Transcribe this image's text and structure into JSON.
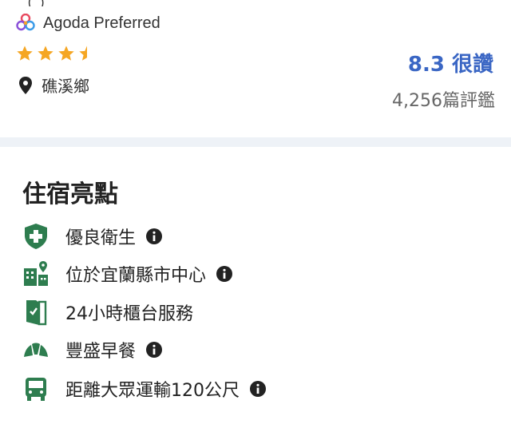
{
  "header": {
    "clipped_text": "（ ）",
    "badge_label": "Agoda Preferred",
    "star_rating": 3.5,
    "location": "礁溪鄉",
    "rating_score": "8.3 很讚",
    "review_count": "4,256篇評鑑"
  },
  "highlights": {
    "title": "住宿亮點",
    "items": [
      {
        "label": "優良衛生",
        "icon": "shield-cross-icon",
        "info": true
      },
      {
        "label": "位於宜蘭縣市中心",
        "icon": "city-center-icon",
        "info": true
      },
      {
        "label": "24小時櫃台服務",
        "icon": "door-check-icon",
        "info": false
      },
      {
        "label": "豐盛早餐",
        "icon": "croissant-icon",
        "info": true
      },
      {
        "label": "距離大眾運輸120公尺",
        "icon": "bus-icon",
        "info": true
      }
    ]
  },
  "colors": {
    "accent_blue": "#3a66c4",
    "icon_green": "#2e7d4f",
    "star_orange": "#f5a623",
    "divider": "#eef2f7"
  }
}
